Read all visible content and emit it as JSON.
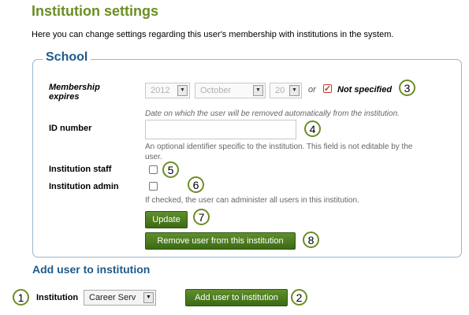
{
  "page": {
    "title": "Institution settings",
    "intro": "Here you can change settings regarding this user's membership with institutions in the system."
  },
  "institution_block": {
    "legend": "School",
    "membership": {
      "label_line1": "Membership",
      "label_line2": "expires",
      "year": "2012",
      "month": "October",
      "day": "20",
      "or_text": "or",
      "not_specified_label": "Not specified",
      "not_specified_checked": true,
      "description": "Date on which the user will be removed automatically from the institution."
    },
    "id_number": {
      "label": "ID number",
      "value": "",
      "description_line1": "An optional identifier specific to the institution. This field is not editable by the",
      "description_line2": "user."
    },
    "institution_staff": {
      "label": "Institution staff",
      "checked": false
    },
    "institution_admin": {
      "label": "Institution admin",
      "checked": false,
      "description": "If checked, the user can administer all users in this institution."
    },
    "update_button": "Update",
    "remove_button": "Remove user from this institution"
  },
  "add_section": {
    "heading": "Add user to institution",
    "institution_label": "Institution",
    "institution_selected": "Career Serv",
    "add_button": "Add user to institution"
  },
  "callouts": [
    "1",
    "2",
    "3",
    "4",
    "5",
    "6",
    "7",
    "8"
  ],
  "colors": {
    "title_green": "#6b8e23",
    "heading_blue": "#1f5a8c",
    "button_green": "#4a7a1e",
    "fieldset_border": "#9ab6cc",
    "checkbox_checked": "#c0392b"
  }
}
